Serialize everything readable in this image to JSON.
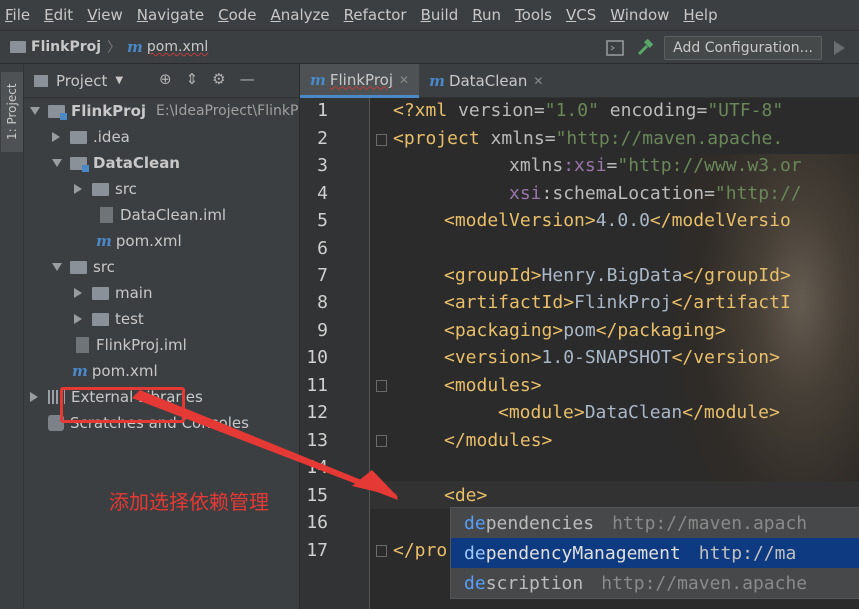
{
  "menu": [
    "File",
    "Edit",
    "View",
    "Navigate",
    "Code",
    "Analyze",
    "Refactor",
    "Build",
    "Run",
    "Tools",
    "VCS",
    "Window",
    "Help"
  ],
  "navbar": {
    "project": "FlinkProj",
    "file": "pom.xml",
    "add_config": "Add Configuration..."
  },
  "toolstrip": {
    "project_tab": "1: Project"
  },
  "project_panel": {
    "title": "Project",
    "tree": {
      "root": "FlinkProj",
      "root_path": "E:\\IdeaProject\\FlinkPr",
      "idea": ".idea",
      "dataclean": "DataClean",
      "dc_src": "src",
      "dc_iml": "DataClean.iml",
      "dc_pom": "pom.xml",
      "src": "src",
      "main": "main",
      "test": "test",
      "iml": "FlinkProj.iml",
      "pom": "pom.xml",
      "ext_libs": "External Libraries",
      "scratches": "Scratches and Consoles"
    }
  },
  "tabs": [
    {
      "label": "FlinkProj",
      "active": true
    },
    {
      "label": "DataClean",
      "active": false
    }
  ],
  "line_numbers": [
    "1",
    "2",
    "3",
    "4",
    "5",
    "6",
    "7",
    "8",
    "9",
    "10",
    "11",
    "12",
    "13",
    "14",
    "15",
    "16",
    "17"
  ],
  "code": {
    "l1_a": "<?xml ",
    "l1_b": "version",
    "l1_c": "=",
    "l1_d": "\"1.0\"",
    "l1_e": " encoding",
    "l1_f": "=",
    "l1_g": "\"UTF-8\"",
    "l2_a": "<project ",
    "l2_b": "xmlns",
    "l2_c": "=",
    "l2_d": "\"http://maven.apache.",
    "l3_a": "xmlns",
    "l3_b": ":xsi",
    "l3_c": "=",
    "l3_d": "\"http://www.w3.or",
    "l4_a": "xsi",
    "l4_b": ":schemaLocation",
    "l4_c": "=",
    "l4_d": "\"http://",
    "l5_open": "<modelVersion>",
    "l5_val": "4.0.0",
    "l5_close": "</modelVersio",
    "l7_open": "<groupId>",
    "l7_val": "Henry.BigData",
    "l7_close": "</groupId>",
    "l8_open": "<artifactId>",
    "l8_val": "FlinkProj",
    "l8_close": "</artifactI",
    "l9_open": "<packaging>",
    "l9_val": "pom",
    "l9_close": "</packaging>",
    "l10_open": "<version>",
    "l10_val": "1.0-SNAPSHOT",
    "l10_close": "</version>",
    "l11": "<modules>",
    "l12_open": "<module>",
    "l12_val": "DataClean",
    "l12_close": "</module>",
    "l13": "</modules>",
    "l15_a": "<de",
    "l15_b": ">",
    "l17": "</pro"
  },
  "autocomplete": [
    {
      "match": "de",
      "rest": "pendencies",
      "url": "http://maven.apach",
      "selected": false
    },
    {
      "match": "de",
      "rest": "pendencyManagement",
      "url": "http://ma",
      "selected": true
    },
    {
      "match": "de",
      "rest": "scription",
      "url": "http://maven.apache",
      "selected": false
    }
  ],
  "annotation": "添加选择依赖管理",
  "colors": {
    "highlight": "#e53935",
    "selection": "#0d3a80",
    "tag": "#e8bf6a",
    "string": "#6a8759"
  }
}
